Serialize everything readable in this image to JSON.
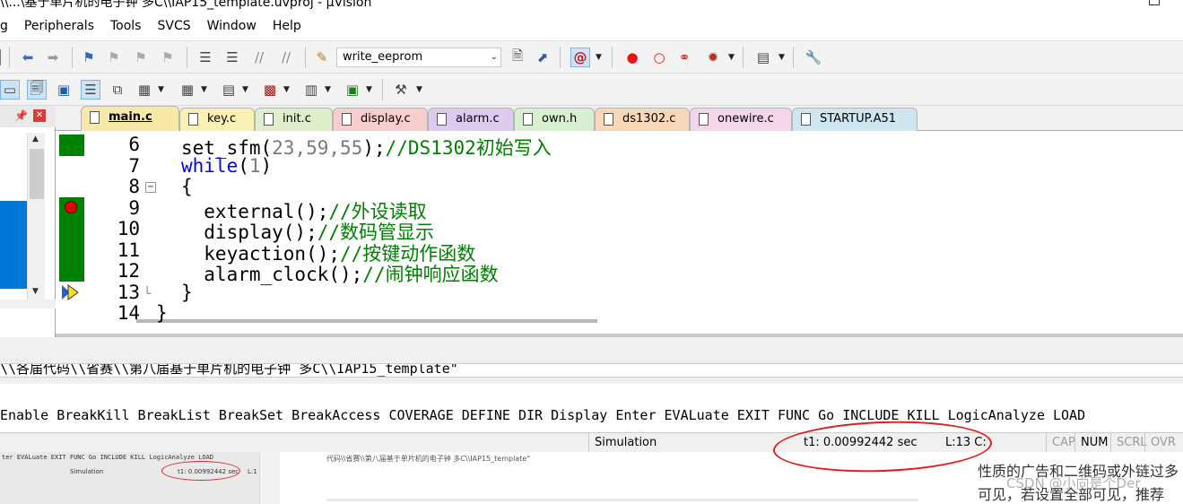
{
  "window": {
    "title": "\\\\...\\基于单片机的电子钟 多C\\\\IAP15_template.uvproj - µVision"
  },
  "menu": [
    "g",
    "Peripherals",
    "Tools",
    "SVCS",
    "Window",
    "Help"
  ],
  "toolbar": {
    "target": "write_eeprom"
  },
  "tabs": [
    {
      "label": "main.c",
      "color": "#f7e9a8",
      "active": true
    },
    {
      "label": "key.c",
      "color": "#f9f0b6",
      "active": false
    },
    {
      "label": "init.c",
      "color": "#dfeecb",
      "active": false
    },
    {
      "label": "display.c",
      "color": "#f7cdcd",
      "active": false
    },
    {
      "label": "alarm.c",
      "color": "#dccbee",
      "active": false
    },
    {
      "label": "own.h",
      "color": "#d9efd2",
      "active": false
    },
    {
      "label": "ds1302.c",
      "color": "#f8d8b8",
      "active": false
    },
    {
      "label": "onewire.c",
      "color": "#f3d6e9",
      "active": false
    },
    {
      "label": "STARTUP.A51",
      "color": "#cde6ef",
      "active": false
    }
  ],
  "code": {
    "lines": [
      {
        "n": "6",
        "parts": [
          {
            "t": "set_sfm(",
            "c": ""
          },
          {
            "t": "23,59,55",
            "c": "num"
          },
          {
            "t": ");",
            "c": ""
          },
          {
            "t": "//DS1302初始写入",
            "c": "cmt"
          }
        ]
      },
      {
        "n": "7",
        "parts": [
          {
            "t": "while",
            "c": "kw"
          },
          {
            "t": "(",
            "c": ""
          },
          {
            "t": "1",
            "c": "num"
          },
          {
            "t": ")",
            "c": ""
          }
        ]
      },
      {
        "n": "8",
        "parts": [
          {
            "t": "{",
            "c": ""
          }
        ]
      },
      {
        "n": "9",
        "parts": [
          {
            "t": "  external();",
            "c": ""
          },
          {
            "t": "//外设读取",
            "c": "cmt"
          }
        ]
      },
      {
        "n": "10",
        "parts": [
          {
            "t": "  display();",
            "c": ""
          },
          {
            "t": "//数码管显示",
            "c": "cmt"
          }
        ]
      },
      {
        "n": "11",
        "parts": [
          {
            "t": "  keyaction();",
            "c": ""
          },
          {
            "t": "//按键动作函数",
            "c": "cmt"
          }
        ]
      },
      {
        "n": "12",
        "parts": [
          {
            "t": "  alarm_clock();",
            "c": ""
          },
          {
            "t": "//闹钟响应函数",
            "c": "cmt"
          }
        ]
      },
      {
        "n": "13",
        "parts": [
          {
            "t": "}",
            "c": ""
          }
        ]
      },
      {
        "n": "14",
        "parts": [
          {
            "t": "}",
            "c": ""
          }
        ]
      }
    ]
  },
  "command": {
    "output_line": "\\\\各届代码\\\\省赛\\\\第八届基于单片机的电子钟 多C\\\\IAP15_template\"",
    "keywords": "Enable BreakKill BreakList BreakSet BreakAccess COVERAGE DEFINE DIR Display Enter EVALuate EXIT FUNC Go INCLUDE KILL LogicAnalyze LOAD"
  },
  "status": {
    "mode": "Simulation",
    "time": "t1: 0.00992442 sec",
    "cursor": "L:13 C:",
    "cap": "CAP",
    "num": "NUM",
    "scrl": "SCRL",
    "ovr": "OVR"
  },
  "overlay": {
    "thumb_keywords": "ter EVALuate EXIT FUNC Go INCLUDE KILL LogicAnalyze LOAD",
    "thumb_mode": "Simulation",
    "thumb_time": "t1: 0.00992442 sec",
    "thumb_cursor": "L:1",
    "mid_text": "代码\\\\省赛\\\\第八届基于单片机的电子钟 多C\\\\IAP15_template\"",
    "article_line1": "性质的广告和二维码或外链过多",
    "article_line2": "可见，若设置全部可见，推荐",
    "watermark": "CSDN @小向是个Der"
  }
}
